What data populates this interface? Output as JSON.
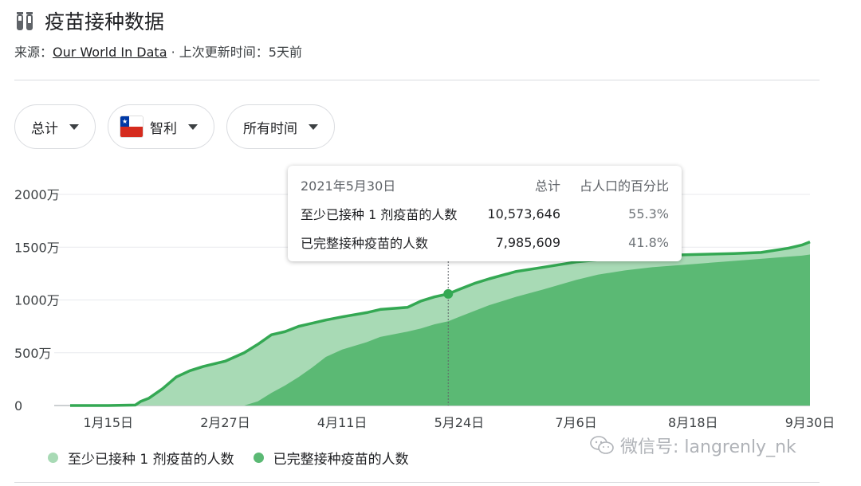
{
  "header": {
    "title": "疫苗接种数据",
    "source_prefix": "来源：",
    "source_link": "Our World In Data",
    "updated": " · 上次更新时间：5天前"
  },
  "filters": {
    "metric": "总计",
    "country": "智利",
    "time": "所有时间"
  },
  "tooltip": {
    "date": "2021年5月30日",
    "col_total": "总计",
    "col_pct": "占人口的百分比",
    "rows": [
      {
        "label": "至少已接种 1 剂疫苗的人数",
        "total": "10,573,646",
        "pct": "55.3%"
      },
      {
        "label": "已完整接种疫苗的人数",
        "total": "7,985,609",
        "pct": "41.8%"
      }
    ]
  },
  "legend": {
    "items": [
      {
        "label": "至少已接种 1 剂疫苗的人数",
        "color": "#a8dab5"
      },
      {
        "label": "已完整接种疫苗的人数",
        "color": "#5bb974"
      }
    ]
  },
  "watermark": "微信号: langrenly_nk",
  "colors": {
    "light": "#a8dab5",
    "dark": "#5bb974",
    "line": "#34a853"
  },
  "chart_data": {
    "type": "area",
    "title": "",
    "xlabel": "",
    "ylabel": "",
    "ylim": [
      0,
      20000000
    ],
    "y_ticks": [
      0,
      5000000,
      10000000,
      15000000,
      20000000
    ],
    "y_tick_labels": [
      "0",
      "500万",
      "1000万",
      "1500万",
      "2000万"
    ],
    "x_tick_labels": [
      "1月15日",
      "2月27日",
      "4月11日",
      "5月24日",
      "7月6日",
      "8月18日",
      "9月30日"
    ],
    "x_range_days": [
      -14,
      258
    ],
    "x_tick_days": [
      0,
      43,
      86,
      129,
      172,
      215,
      258
    ],
    "days": [
      -14,
      0,
      10,
      12,
      15,
      20,
      25,
      30,
      35,
      43,
      50,
      55,
      60,
      65,
      70,
      75,
      80,
      86,
      95,
      100,
      110,
      115,
      120,
      125,
      129,
      135,
      140,
      150,
      160,
      172,
      180,
      190,
      200,
      215,
      230,
      240,
      250,
      255,
      258
    ],
    "series": [
      {
        "name": "至少已接种 1 剂疫苗的人数",
        "values": [
          0,
          0,
          50000,
          400000,
          700000,
          1600000,
          2700000,
          3300000,
          3700000,
          4200000,
          5000000,
          5800000,
          6700000,
          7000000,
          7500000,
          7800000,
          8100000,
          8400000,
          8800000,
          9100000,
          9300000,
          9900000,
          10300000,
          10573646,
          11000000,
          11600000,
          12000000,
          12700000,
          13100000,
          13600000,
          13800000,
          14000000,
          14200000,
          14300000,
          14400000,
          14500000,
          14900000,
          15200000,
          15500000
        ]
      },
      {
        "name": "已完整接种疫苗的人数",
        "values": [
          0,
          0,
          0,
          0,
          0,
          0,
          0,
          0,
          0,
          0,
          0,
          400000,
          1200000,
          1900000,
          2700000,
          3600000,
          4600000,
          5300000,
          6000000,
          6500000,
          7000000,
          7300000,
          7700000,
          7985609,
          8400000,
          9000000,
          9500000,
          10300000,
          11000000,
          11900000,
          12400000,
          12800000,
          13100000,
          13400000,
          13700000,
          13900000,
          14100000,
          14200000,
          14300000
        ]
      }
    ],
    "highlight": {
      "day": 125,
      "label": "2021年5月30日"
    }
  }
}
